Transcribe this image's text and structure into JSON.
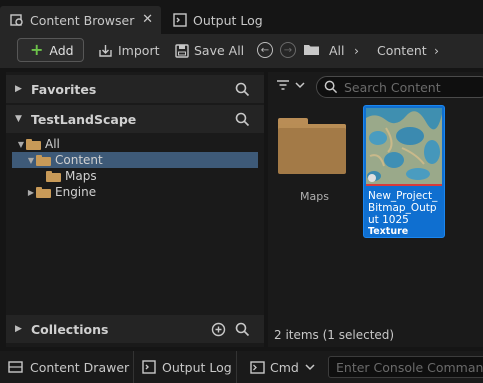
{
  "tabs": [
    {
      "label": "Content Browser",
      "active": true,
      "icon": "content-browser-icon",
      "close": "✕"
    },
    {
      "label": "Output Log",
      "active": false,
      "icon": "output-log-icon"
    }
  ],
  "toolbar": {
    "add_label": "Add",
    "import_label": "Import",
    "save_all_label": "Save All",
    "breadcrumb": [
      "All",
      "Content"
    ]
  },
  "left_panel": {
    "favorites_label": "Favorites",
    "project_label": "TestLandScape",
    "collections_label": "Collections",
    "tree": [
      {
        "label": "All",
        "level": 0,
        "expanded": true,
        "selected": false
      },
      {
        "label": "Content",
        "level": 1,
        "expanded": true,
        "selected": true
      },
      {
        "label": "Maps",
        "level": 2,
        "expanded": false,
        "selected": false
      },
      {
        "label": "Engine",
        "level": 1,
        "expanded": false,
        "selected": false
      }
    ]
  },
  "right_panel": {
    "search_placeholder": "Search Content",
    "folder_label": "Maps",
    "asset_name": "New_Project_Bitmap_Output 1025",
    "asset_type": "Texture",
    "status": "2 items (1 selected)"
  },
  "bottom_bar": {
    "content_drawer_label": "Content Drawer",
    "output_log_label": "Output Log",
    "cmd_label": "Cmd",
    "console_placeholder": "Enter Console Command"
  },
  "colors": {
    "accent_selected": "#0f6fd0",
    "tree_selected": "#3e5a78",
    "folder": "#c89a58",
    "add_plus": "#6cc24a"
  }
}
